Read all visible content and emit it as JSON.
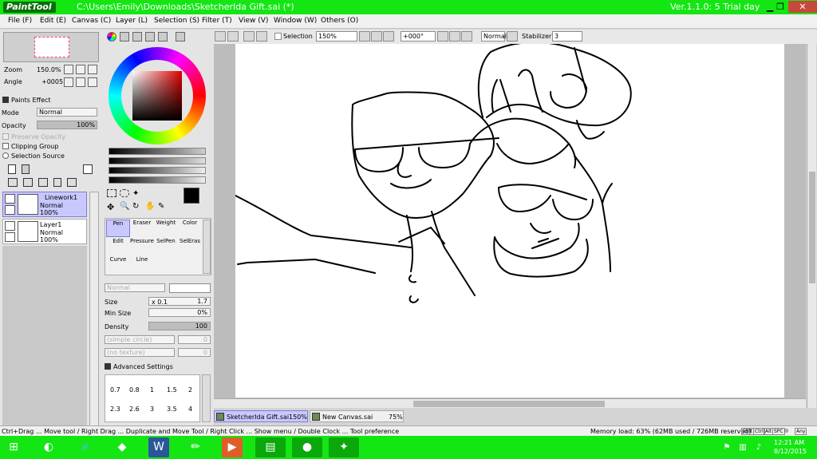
{
  "title": {
    "app": "PaintTool SAI",
    "path": "C:\\Users\\Emily\\Downloads\\SketcherIda Gift.sai (*)",
    "version": "Ver.1.1.0: 5 Trial day"
  },
  "menu": [
    "File (F)",
    "Edit (E)",
    "Canvas (C)",
    "Layer (L)",
    "Selection (S)",
    "Filter (T)",
    "View (V)",
    "Window (W)",
    "Others (O)"
  ],
  "toolbar": {
    "selection_label": "Selection",
    "zoom": "150%",
    "angle": "+000°",
    "blend": "Normal",
    "stabilizer_label": "Stabilizer",
    "stabilizer": "3"
  },
  "navigator": {
    "zoom_label": "Zoom",
    "zoom": "150.0%",
    "angle_label": "Angle",
    "angle": "+0005"
  },
  "layer_panel": {
    "paints_effect": "Paints Effect",
    "mode_label": "Mode",
    "mode": "Normal",
    "opacity_label": "Opacity",
    "opacity": "100%",
    "opacity_fill": 1.0,
    "preserve_opacity": "Preserve Opacity",
    "clipping_group": "Clipping Group",
    "selection_source": "Selection Source",
    "layers": [
      {
        "name": "Linework1",
        "mode": "Normal",
        "opacity": "100%"
      },
      {
        "name": "Layer1",
        "mode": "Normal",
        "opacity": "100%"
      }
    ]
  },
  "tools": [
    {
      "label": "Pen"
    },
    {
      "label": "Eraser"
    },
    {
      "label": "Weight"
    },
    {
      "label": "Color"
    },
    {
      "label": "Edit"
    },
    {
      "label": "Pressure"
    },
    {
      "label": "SelPen"
    },
    {
      "label": "SelEras"
    },
    {
      "label": "Curve"
    },
    {
      "label": "Line"
    }
  ],
  "brush": {
    "mode": "Normal",
    "size_label": "Size",
    "size_mult": "x 0.1",
    "size": "1.7",
    "min_size_label": "Min Size",
    "min_size": "0%",
    "density_label": "Density",
    "density": "100",
    "shape": "(simple circle)",
    "texture": "(no texture)",
    "shape_val": "0",
    "texture_val": "0",
    "advanced": "Advanced Settings",
    "size_presets_row1": [
      "0.7",
      "0.8",
      "1",
      "1.5",
      "2"
    ],
    "size_presets_row2": [
      "2.3",
      "2.6",
      "3",
      "3.5",
      "4"
    ]
  },
  "canvas_tabs": [
    {
      "name": "SketcherIda Gift.sai",
      "zoom": "150%"
    },
    {
      "name": "New Canvas.sai",
      "zoom": "75%"
    }
  ],
  "status": {
    "hint": "Ctrl+Drag ... Move tool / Right Drag ... Duplicate and Move Tool / Right Click ... Show menu / Double Clock ... Tool preference",
    "memory": "Memory load: 63% (62MB used / 726MB reserved)",
    "keys": [
      "Shft",
      "Ctrl",
      "Alt",
      "SPC",
      "◎",
      "Any"
    ]
  },
  "clock": {
    "time": "12:21 AM",
    "date": "8/12/2015"
  },
  "colors": {
    "accent_green": "#14e614",
    "selected_layer": "#c8c8ff"
  }
}
